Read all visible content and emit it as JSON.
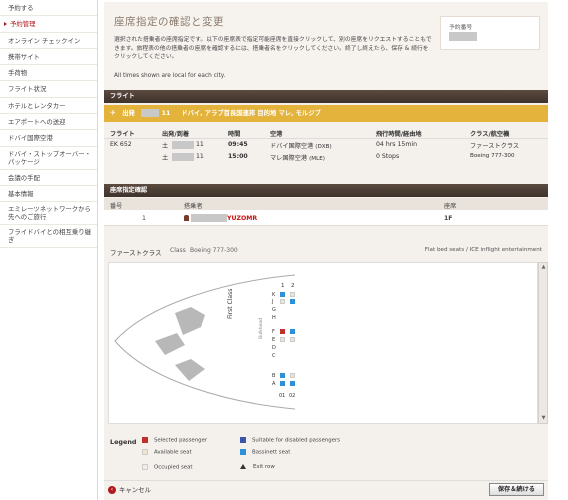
{
  "sidebar": {
    "items": [
      {
        "label": "予約する"
      },
      {
        "label": "予約管理"
      },
      {
        "label": "オンライン チェックイン"
      },
      {
        "label": "携帯サイト"
      },
      {
        "label": "手荷物"
      },
      {
        "label": "フライト状況"
      },
      {
        "label": "ホテルとレンタカー"
      },
      {
        "label": "エアポートへの送迎"
      },
      {
        "label": "ドバイ国際空港"
      },
      {
        "label": "ドバイ・ストップオーバー・パッケージ"
      },
      {
        "label": "会議の手配"
      },
      {
        "label": "基本情報"
      },
      {
        "label": "エミレーツネットワークから先へのご旅行"
      },
      {
        "label": "フライドバイとの相互乗り継ぎ"
      }
    ]
  },
  "header": {
    "title": "座席指定の確認と変更",
    "intro": "選択された搭乗者の座席指定です。以下の座席表で指定可能座席を直接クリックして、別の座席をリクエストすることもできます。旅程表の他の搭乗者の座席を確認するには、搭乗者名をクリックしてください。終了し終えたら、保存 & 続行をクリックしてください。",
    "note": "All times shown are local for each city.",
    "ref_label": "予約番号"
  },
  "flight_section": {
    "title": "フライト",
    "route_bar": {
      "direction": "出発",
      "day": "11",
      "route": "ドバイ, アラブ首長国連邦 目的地 マレ, モルジブ"
    },
    "columns": [
      "フライト",
      "出発/到着",
      "時間",
      "空港",
      "飛行時間/経由地",
      "クラス/航空機"
    ],
    "row": {
      "flight": "EK 652",
      "dep_day": "土",
      "dep_date": "11",
      "dep_time": "09:45",
      "dep_airport": "ドバイ国際空港",
      "dep_code": "(DXB)",
      "arr_day": "土",
      "arr_date": "11",
      "arr_time": "15:00",
      "arr_airport": "マレ国際空港",
      "arr_code": "(MLE)",
      "duration": "04 hrs 15min",
      "stops": "0 Stops",
      "class": "ファーストクラス",
      "aircraft": "Boeing 777-300"
    }
  },
  "seat_section": {
    "title": "座席指定確認",
    "columns": [
      "番号",
      "搭乗者",
      "座席"
    ],
    "row": {
      "number": "1",
      "passenger": "YUZOMR",
      "seat": "1F"
    }
  },
  "cabin": {
    "class": "ファーストクラス",
    "class_label": "Class",
    "aircraft": "Boeing 777-300",
    "features": "Flat bed seats / ICE inflight entertainment",
    "cabin_label": "First Class",
    "bulkhead": "Bulkhead",
    "col_nums": [
      "1",
      "2"
    ],
    "rows_top": [
      "K",
      "J",
      "G",
      "H"
    ],
    "rows_mid": [
      "F",
      "E",
      "D",
      "C"
    ],
    "rows_bot": [
      "B",
      "A"
    ],
    "bottom_nums": [
      "01",
      "02"
    ]
  },
  "legend": {
    "title": "Legend",
    "selected": "Selected passenger",
    "available": "Available seat",
    "occupied": "Occupied seat",
    "disabled": "Suitable for disabled passengers",
    "bassinet": "Bassinett seat",
    "exit": "Exit row",
    "colors": {
      "selected": "#c0302a",
      "available": "#ece4cf",
      "occupied": "#eeeeee",
      "disabled": "#3d55a8",
      "bassinet": "#2e90d8"
    }
  },
  "footer": {
    "cancel": "キャンセル",
    "save": "保存＆続ける"
  }
}
